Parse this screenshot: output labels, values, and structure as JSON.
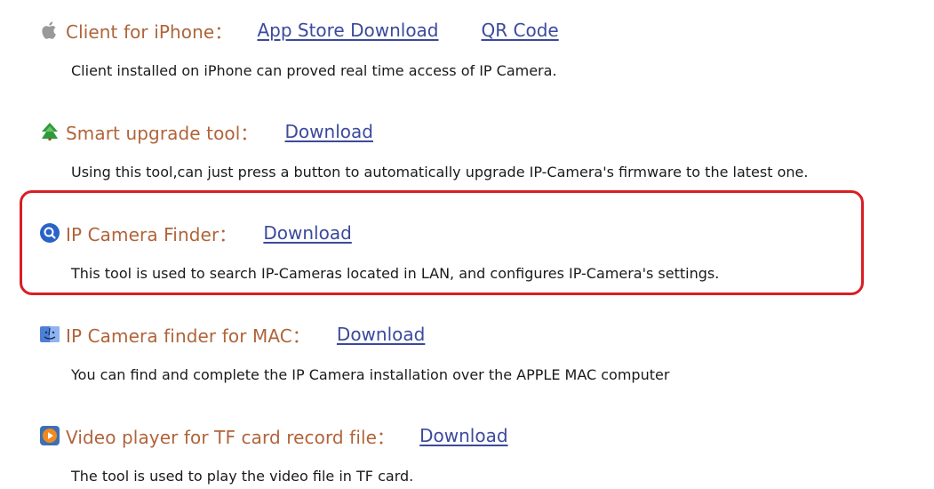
{
  "items": [
    {
      "icon": "apple-icon",
      "title": "Client for iPhone：",
      "links": [
        "App Store Download",
        "QR Code"
      ],
      "description": "Client installed on iPhone can proved real time access of IP Camera."
    },
    {
      "icon": "upgrade-tree-icon",
      "title": "Smart upgrade tool：",
      "links": [
        "Download"
      ],
      "description": "Using this tool,can just press a button to automatically upgrade IP-Camera's firmware to the latest one."
    },
    {
      "icon": "search-icon",
      "title": "IP Camera Finder：",
      "links": [
        "Download"
      ],
      "description": "This tool is used to search IP-Cameras located in LAN, and configures IP-Camera's settings."
    },
    {
      "icon": "mac-finder-icon",
      "title": "IP Camera finder for MAC：",
      "links": [
        "Download"
      ],
      "description": "You can find and complete the IP Camera installation over the APPLE MAC computer"
    },
    {
      "icon": "video-player-icon",
      "title": "Video player for TF card record file：",
      "links": [
        "Download"
      ],
      "description": "The tool is used to play the video file in TF card."
    }
  ],
  "colors": {
    "title": "#b0643a",
    "link": "#3b4a9c",
    "highlight": "#d81e25"
  }
}
